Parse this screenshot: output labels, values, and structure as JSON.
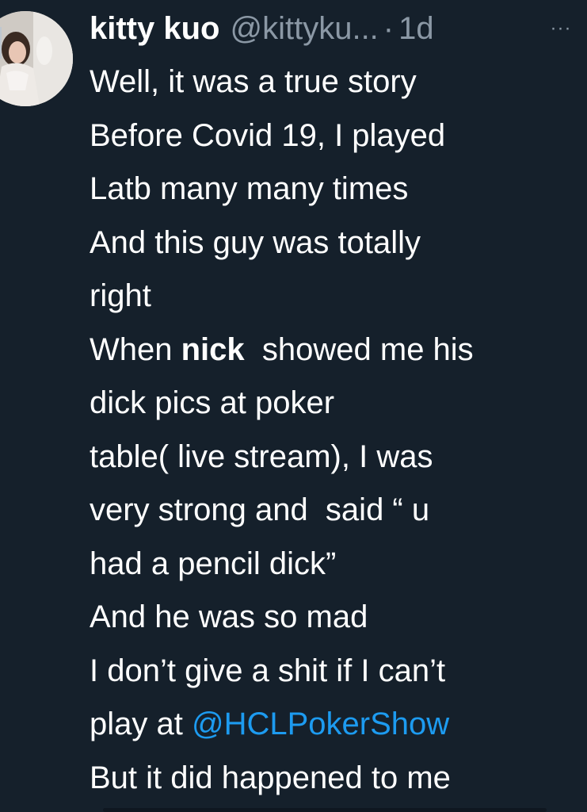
{
  "tweet": {
    "author": {
      "display_name": "kitty kuo",
      "handle": "@kittyku...",
      "separator": "·",
      "time": "1d"
    },
    "more_label": "···",
    "lines": {
      "l1": "Well, it was a true story",
      "l2": "Before Covid 19, I played",
      "l3": "Latb many many times",
      "l4": "And this guy was totally",
      "l5": "right",
      "l6_pre": "When ",
      "l6_bold": "nick",
      "l6_post": "  showed me his",
      "l7": "dick pics at poker",
      "l8": "table( live stream), I was",
      "l9": "very strong and  said “ u",
      "l10": "had a pencil dick”",
      "l11": "And he was so mad",
      "l12": "I don’t give a shit if I can’t",
      "l13_pre": "play at ",
      "l13_mention": "@HCLPokerShow",
      "l14": "But it did happened to me"
    }
  },
  "colors": {
    "background": "#15202b",
    "text": "#ffffff",
    "secondary": "#8b98a5",
    "link": "#1d9bf0"
  },
  "icons": {
    "avatar": "profile-photo",
    "more": "more-options-icon"
  }
}
